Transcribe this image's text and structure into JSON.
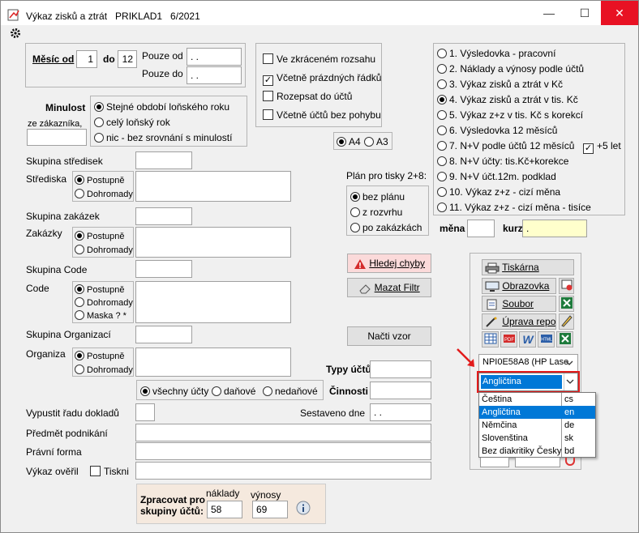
{
  "window": {
    "title": "Výkaz zisků a ztrát   PRIKLAD1   6/2021",
    "minimize": "—",
    "maximize": "☐",
    "close": "✕"
  },
  "period": {
    "mesic_od_label": "Měsíc od",
    "from": "1",
    "do_label": "do",
    "to": "12",
    "pouze_od_label": "Pouze od",
    "pouze_do_label": "Pouze do",
    "pouze_od_value": " .  .",
    "pouze_do_value": " .  ."
  },
  "options": {
    "zkraceny": "Ve zkráceném rozsahu",
    "prazdne": "Včetně prázdných řádků",
    "rozepsat": "Rozepsat do účtů",
    "bez_pohybu": "Včetně účtů bez pohybu"
  },
  "minulost": {
    "label": "Minulost",
    "sub": "ze zákazníka,",
    "opts": [
      "Stejné období loňského roku",
      "celý loňský rok",
      "nic - bez srovnání s minulostí"
    ]
  },
  "paper": {
    "a4": "A4",
    "a3": "A3"
  },
  "reports": [
    "1. Výsledovka - pracovní",
    "2. Náklady a výnosy podle účtů",
    "3. Výkaz zisků a ztrát v Kč",
    "4. Výkaz zisků a ztrát v tis. Kč",
    "5. Výkaz z+z v tis. Kč s korekcí",
    "6. Výsledovka 12 měsíců",
    "7. N+V podle účtů 12 měsíců",
    "8. N+V  účty: tis.Kč+korekce",
    "9. N+V účt.12m. podklad",
    "10. Výkaz z+z - cizí měna",
    "11. Výkaz z+z - cizí měna - tisíce"
  ],
  "plus5": "+5 let",
  "mena": {
    "mena_label": "měna",
    "kurz_label": "kurz",
    "kurz_value": "."
  },
  "filters": {
    "skupina_stredisek": "Skupina středisek",
    "strediska": "Střediska",
    "skupina_zakazek": "Skupina zakázek",
    "zakazky": "Zakázky",
    "skupina_code": "Skupina Code",
    "code": "Code",
    "skupina_org": "Skupina Organizací",
    "organizace": "Organiza",
    "postupne": "Postupně",
    "dohromady": "Dohromady",
    "maska": "Maska ? *"
  },
  "plan": {
    "label": "Plán pro tisky 2+8:",
    "opts": [
      "bez plánu",
      "z rozvrhu",
      "po zakázkách"
    ]
  },
  "buttons": {
    "hledej": "Hledej chyby",
    "mazat": "Mazat Filtr",
    "nacti": "Načti vzor"
  },
  "output": {
    "tiskarna": "Tiskárna",
    "obrazovka": "Obrazovka",
    "soubor": "Soubor",
    "uprava": "Úprava repor",
    "printer_value": "NPI0E58A8 (HP Lase",
    "language_value": "Angličtina"
  },
  "languages": [
    {
      "name": "Čeština",
      "code": "cs"
    },
    {
      "name": "Angličtina",
      "code": "en"
    },
    {
      "name": "Němčina",
      "code": "de"
    },
    {
      "name": "Slovenština",
      "code": "sk"
    },
    {
      "name": "Bez diakritiky Česky",
      "code": "bd"
    }
  ],
  "accounts": {
    "opts": [
      "všechny účty",
      "daňové",
      "nedaňové"
    ],
    "typy_uctu": "Typy účtů",
    "cinnosti": "Činnosti"
  },
  "bottom": {
    "vypustit": "Vypustit řadu dokladů",
    "sestaveno": "Sestaveno dne",
    "sestaveno_value": " .  .",
    "predmet": "Předmět podnikání",
    "pravni": "Právní forma",
    "overil": "Výkaz ověřil",
    "tiskni": "Tiskni"
  },
  "zpracovat": {
    "label1": "Zpracovat pro",
    "label2": "skupiny účtů:",
    "naklady_label": "náklady",
    "vynosy_label": "výnosy",
    "naklady": "58",
    "vynosy": "69"
  }
}
